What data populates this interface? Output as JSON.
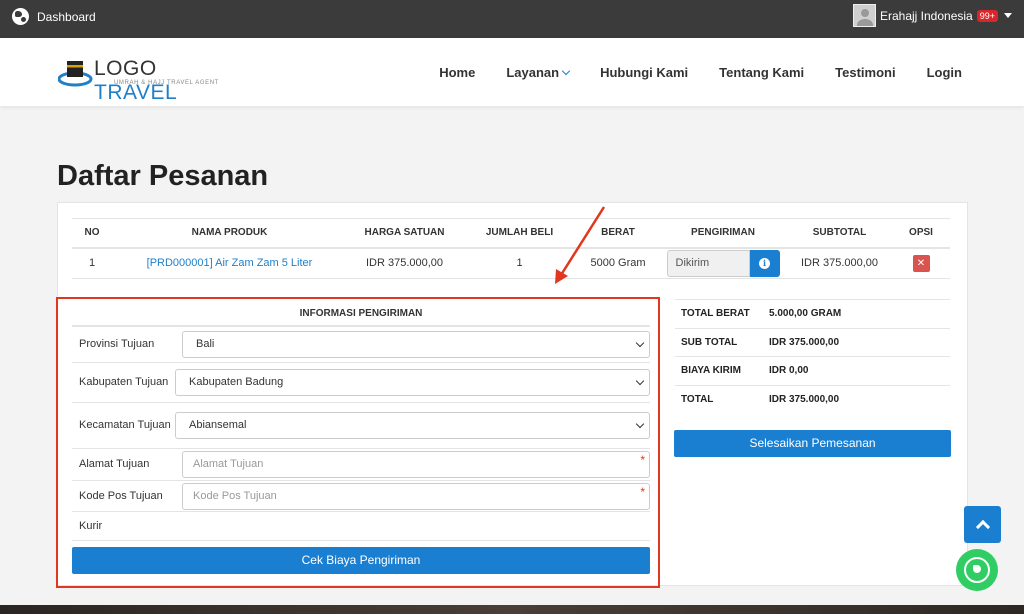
{
  "topbar": {
    "left_label": "Dashboard",
    "user_name": "Erahajj Indonesia",
    "notif_badge": "99+"
  },
  "brand": {
    "logo_part1": "LOGO",
    "logo_part2": "TRAVEL",
    "tagline": "UMRAH & HAJJ TRAVEL AGENT"
  },
  "nav": {
    "items": [
      "Home",
      "Layanan",
      "Hubungi Kami",
      "Tentang Kami",
      "Testimoni",
      "Login"
    ]
  },
  "page": {
    "title": "Daftar Pesanan"
  },
  "orders": {
    "headers": [
      "NO",
      "NAMA PRODUK",
      "HARGA SATUAN",
      "JUMLAH BELI",
      "BERAT",
      "PENGIRIMAN",
      "SUBTOTAL",
      "OPSI"
    ],
    "rows": [
      {
        "no": "1",
        "product": "[PRD000001] Air Zam Zam 5 Liter",
        "price": "IDR 375.000,00",
        "qty": "1",
        "weight": "5000 Gram",
        "shipping": "Dikirim",
        "subtotal": "IDR 375.000,00"
      }
    ]
  },
  "shipping_form": {
    "title": "INFORMASI PENGIRIMAN",
    "province_label": "Provinsi Tujuan",
    "province_value": "Bali",
    "regency_label": "Kabupaten Tujuan",
    "regency_value": "Kabupaten Badung",
    "district_label": "Kecamatan Tujuan",
    "district_value": "Abiansemal",
    "address_label": "Alamat Tujuan",
    "address_placeholder": "Alamat Tujuan",
    "postal_label": "Kode Pos Tujuan",
    "postal_placeholder": "Kode Pos Tujuan",
    "courier_label": "Kurir",
    "required_mark": "*",
    "check_button": "Cek Biaya Pengiriman"
  },
  "summary": {
    "rows": [
      {
        "label": "TOTAL BERAT",
        "value": "5.000,00 GRAM"
      },
      {
        "label": "SUB TOTAL",
        "value": "IDR 375.000,00"
      },
      {
        "label": "BIAYA KIRIM",
        "value": "IDR 0,00"
      },
      {
        "label": "TOTAL",
        "value": "IDR 375.000,00"
      }
    ],
    "finish_button": "Selesaikan Pemesanan"
  },
  "colors": {
    "primary": "#1a7fd1",
    "highlight": "#e1371e",
    "topbar": "#3b3b3b"
  }
}
